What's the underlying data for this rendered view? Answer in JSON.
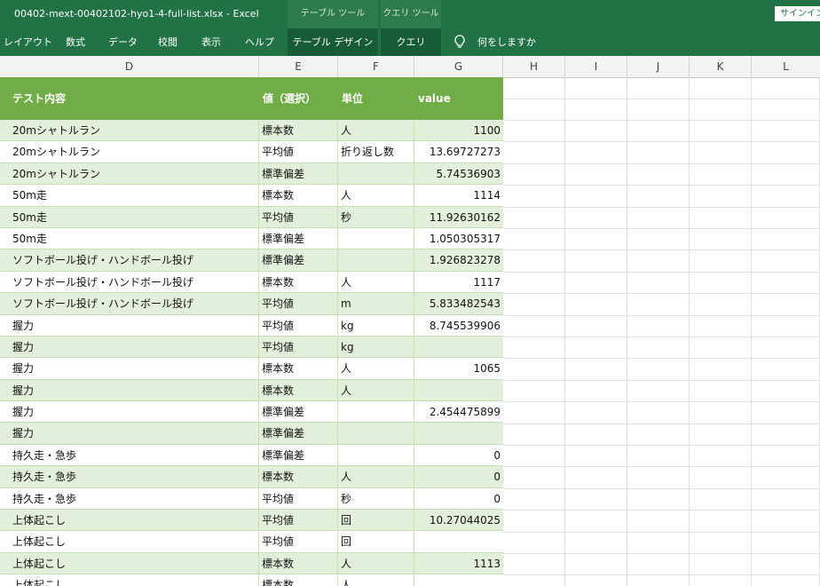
{
  "titlebar": {
    "doc_title": "00402-mext-00402102-hyo1-4-full-list.xlsx  -  Excel",
    "context_table_tools": "テーブル ツール",
    "context_query_tools": "クエリ ツール",
    "signin": "サインイン"
  },
  "ribbon": {
    "tabs": [
      "レイアウト",
      "数式",
      "データ",
      "校閲",
      "表示",
      "ヘルプ",
      "テーブル デザイン",
      "クエリ"
    ],
    "tell_me": "何をしますか"
  },
  "sheet": {
    "columns": [
      "D",
      "E",
      "F",
      "G",
      "H",
      "I",
      "J",
      "K",
      "L"
    ],
    "table_headers": [
      "テスト内容",
      "値（選択）",
      "単位",
      "value"
    ],
    "rows": [
      [
        "20mシャトルラン",
        "標本数",
        "人",
        "1100"
      ],
      [
        "20mシャトルラン",
        "平均値",
        "折り返し数",
        "13.69727273"
      ],
      [
        "20mシャトルラン",
        "標準偏差",
        "",
        "5.74536903"
      ],
      [
        "50m走",
        "標本数",
        "人",
        "1114"
      ],
      [
        "50m走",
        "平均値",
        "秒",
        "11.92630162"
      ],
      [
        "50m走",
        "標準偏差",
        "",
        "1.050305317"
      ],
      [
        "ソフトボール投げ・ハンドボール投げ",
        "標準偏差",
        "",
        "1.926823278"
      ],
      [
        "ソフトボール投げ・ハンドボール投げ",
        "標本数",
        "人",
        "1117"
      ],
      [
        "ソフトボール投げ・ハンドボール投げ",
        "平均値",
        "m",
        "5.833482543"
      ],
      [
        "握力",
        "平均値",
        "kg",
        "8.745539906"
      ],
      [
        "握力",
        "平均値",
        "kg",
        ""
      ],
      [
        "握力",
        "標本数",
        "人",
        "1065"
      ],
      [
        "握力",
        "標本数",
        "人",
        ""
      ],
      [
        "握力",
        "標準偏差",
        "",
        "2.454475899"
      ],
      [
        "握力",
        "標準偏差",
        "",
        ""
      ],
      [
        "持久走・急歩",
        "標準偏差",
        "",
        "0"
      ],
      [
        "持久走・急歩",
        "標本数",
        "人",
        "0"
      ],
      [
        "持久走・急歩",
        "平均値",
        "秒",
        "0"
      ],
      [
        "上体起こし",
        "平均値",
        "回",
        "10.27044025"
      ],
      [
        "上体起こし",
        "平均値",
        "回",
        ""
      ],
      [
        "上体起こし",
        "標本数",
        "人",
        "1113"
      ],
      [
        "上体起こし",
        "標本数",
        "人",
        ""
      ]
    ]
  }
}
